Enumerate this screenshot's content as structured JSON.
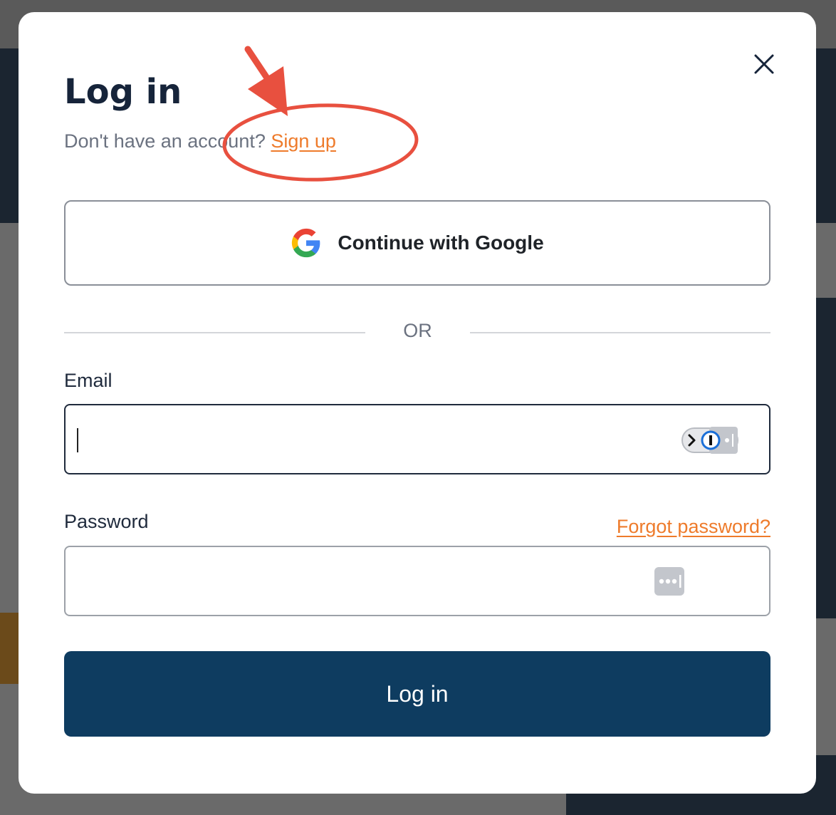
{
  "modal": {
    "title": "Log in",
    "signup_prompt": "Don't have an account?",
    "signup_link": "Sign up",
    "google_button": {
      "label": "Continue with Google",
      "icon": "google-g-icon"
    },
    "divider_text": "OR",
    "email": {
      "label": "Email",
      "value": "",
      "placeholder": ""
    },
    "password": {
      "label": "Password",
      "value": "",
      "placeholder": "",
      "forgot_link": "Forgot password?"
    },
    "submit_label": "Log in",
    "close_icon": "close-icon"
  },
  "colors": {
    "accent_link": "#ee7b2b",
    "primary_button": "#0e3c60",
    "title_text": "#16243a",
    "annotation_red": "#e8503f"
  },
  "annotation": {
    "type": "red-arrow-and-circle",
    "target": "signup-link"
  }
}
